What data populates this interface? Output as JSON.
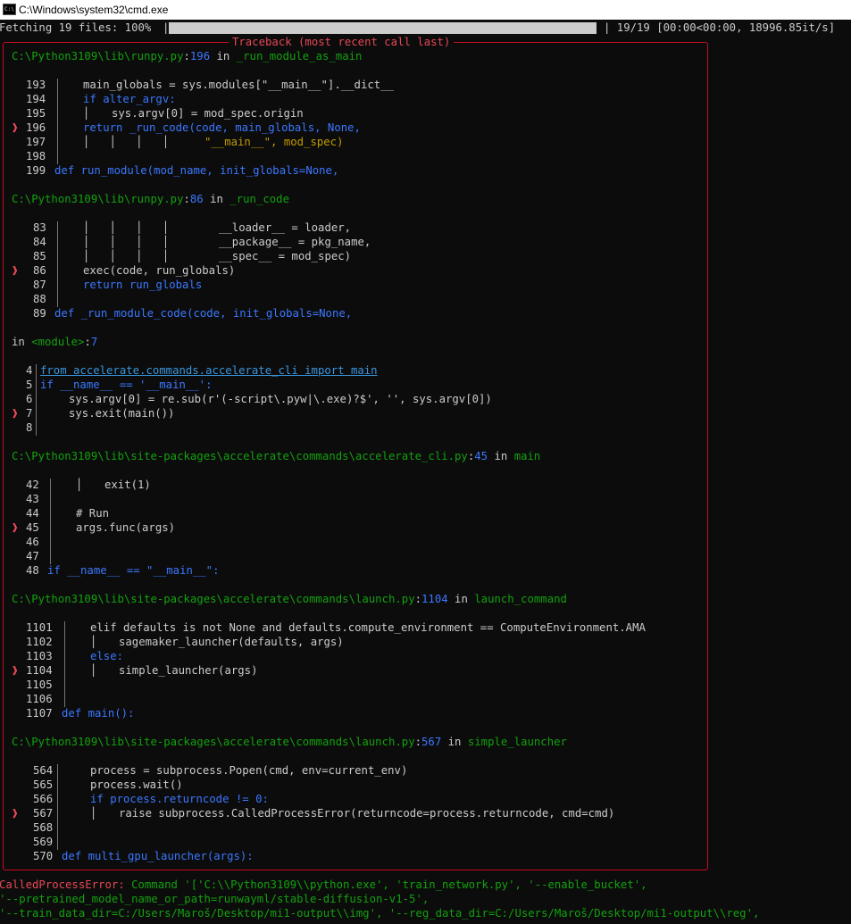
{
  "window": {
    "title": "C:\\Windows\\system32\\cmd.exe",
    "icon": "cmd-icon"
  },
  "progress": {
    "label": "Fetching 19 files: 100%",
    "value": 1.0,
    "stats": "| 19/19 [00:00<00:00, 18996.85it/s]"
  },
  "traceback": {
    "header": "Traceback (most recent call last)",
    "frames": [
      {
        "location": {
          "path": "C:\\Python3109\\lib\\runpy.py",
          "line": "196",
          "in_word": " in ",
          "func": "_run_module_as_main"
        },
        "lines": [
          {
            "num": "193",
            "code": "main_globals = sys.modules[\"__main__\"].__dict__"
          },
          {
            "num": "194",
            "code": "if alter_argv:"
          },
          {
            "num": "195",
            "code": "sys.argv[0] = mod_spec.origin"
          },
          {
            "num": "196",
            "code": "return _run_code(code, main_globals, None,"
          },
          {
            "num": "197",
            "code": "\"__main__\", mod_spec)"
          },
          {
            "num": "198",
            "code": ""
          },
          {
            "num": "199",
            "code": "def run_module(mod_name, init_globals=None,"
          }
        ]
      },
      {
        "location": {
          "path": "C:\\Python3109\\lib\\runpy.py",
          "line": "86",
          "in_word": " in ",
          "func": "_run_code"
        },
        "lines": [
          {
            "num": "83",
            "code": "__loader__ = loader,"
          },
          {
            "num": "84",
            "code": "__package__ = pkg_name,"
          },
          {
            "num": "85",
            "code": "__spec__ = mod_spec)"
          },
          {
            "num": "86",
            "code": "exec(code, run_globals)"
          },
          {
            "num": "87",
            "code": "return run_globals"
          },
          {
            "num": "88",
            "code": ""
          },
          {
            "num": "89",
            "code": "def _run_module_code(code, init_globals=None,"
          }
        ]
      },
      {
        "location": {
          "prefix": "in ",
          "module": "<module>",
          "line": "7"
        },
        "lines": [
          {
            "num": "4",
            "code": "from accelerate.commands.accelerate_cli import main"
          },
          {
            "num": "5",
            "code": "if __name__ == '__main__':"
          },
          {
            "num": "6",
            "code": "sys.argv[0] = re.sub(r'(-script\\.pyw|\\.exe)?$', '', sys.argv[0])"
          },
          {
            "num": "7",
            "code": "sys.exit(main())"
          },
          {
            "num": "8",
            "code": ""
          }
        ]
      },
      {
        "location": {
          "path": "C:\\Python3109\\lib\\site-packages\\accelerate\\commands\\accelerate_cli.py",
          "line": "45",
          "in_word": " in ",
          "func": "main"
        },
        "lines": [
          {
            "num": "42",
            "code": "exit(1)"
          },
          {
            "num": "43",
            "code": ""
          },
          {
            "num": "44",
            "code": "# Run"
          },
          {
            "num": "45",
            "code": "args.func(args)"
          },
          {
            "num": "46",
            "code": ""
          },
          {
            "num": "47",
            "code": ""
          },
          {
            "num": "48",
            "code": "if __name__ == \"__main__\":"
          }
        ]
      },
      {
        "location": {
          "path": "C:\\Python3109\\lib\\site-packages\\accelerate\\commands\\launch.py",
          "line": "1104",
          "in_word": " in ",
          "func": "launch_command"
        },
        "lines": [
          {
            "num": "1101",
            "code": "elif defaults is not None and defaults.compute_environment == ComputeEnvironment.AMA"
          },
          {
            "num": "1102",
            "code": "sagemaker_launcher(defaults, args)"
          },
          {
            "num": "1103",
            "code": "else:"
          },
          {
            "num": "1104",
            "code": "simple_launcher(args)"
          },
          {
            "num": "1105",
            "code": ""
          },
          {
            "num": "1106",
            "code": ""
          },
          {
            "num": "1107",
            "code": "def main():"
          }
        ]
      },
      {
        "location": {
          "path": "C:\\Python3109\\lib\\site-packages\\accelerate\\commands\\launch.py",
          "line": "567",
          "in_word": " in ",
          "func": "simple_launcher"
        },
        "lines": [
          {
            "num": "564",
            "code": "process = subprocess.Popen(cmd, env=current_env)"
          },
          {
            "num": "565",
            "code": "process.wait()"
          },
          {
            "num": "566",
            "code": "if process.returncode != 0:"
          },
          {
            "num": "567",
            "code": "raise subprocess.CalledProcessError(returncode=process.returncode, cmd=cmd)"
          },
          {
            "num": "568",
            "code": ""
          },
          {
            "num": "569",
            "code": ""
          },
          {
            "num": "570",
            "code": "def multi_gpu_launcher(args):"
          }
        ]
      }
    ]
  },
  "error": {
    "type": "CalledProcessError:",
    "message": " Command '['C:\\\\Python3109\\\\python.exe', 'train_network.py', '--enable_bucket',",
    "cont1": "'--pretrained_model_name_or_path=runwayml/stable-diffusion-v1-5',",
    "cont2": "'--train_data_dir=C:/Users/Maroš/Desktop/mi1-output\\\\img', '--reg_data_dir=C:/Users/Maroš/Desktop/mi1-output\\\\reg',"
  },
  "colors": {
    "background": "#0c0c0c",
    "text": "#cccccc",
    "error_red": "#e74856",
    "path_green": "#13a10e",
    "keyword_blue": "#3b78ff",
    "string_yellow": "#c19c00",
    "link_cyan": "#3a96dd",
    "keyword_magenta": "#b4009e"
  }
}
